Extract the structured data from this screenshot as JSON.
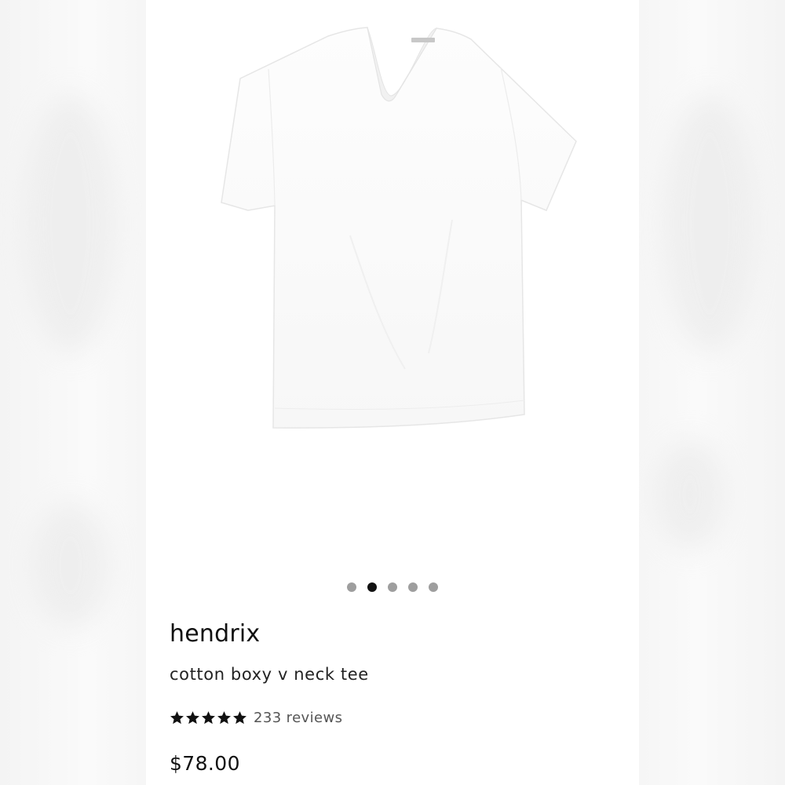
{
  "product": {
    "brand": "hendrix",
    "name": "cotton boxy v neck tee",
    "rating": 5,
    "max_rating": 5,
    "reviews_label": "233 reviews",
    "price": "$78.00",
    "image": {
      "subject": "white v-neck t-shirt",
      "icon": "tshirt-image"
    }
  },
  "carousel": {
    "total_slides": 5,
    "active_index": 1
  },
  "colors": {
    "dot_active": "#111111",
    "dot_inactive": "#9e9e9e",
    "shirt": "#ffffff",
    "shirt_shadow": "#e8e8e8"
  }
}
